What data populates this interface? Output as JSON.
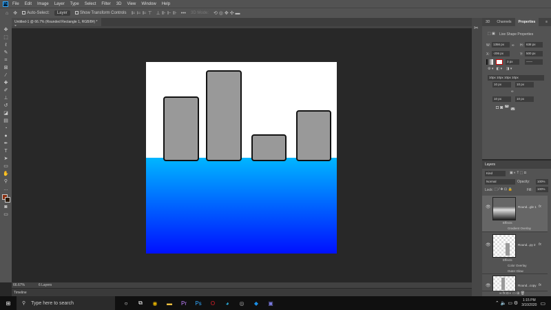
{
  "app": {
    "logo": "Ps",
    "menu": [
      "File",
      "Edit",
      "Image",
      "Layer",
      "Type",
      "Select",
      "Filter",
      "3D",
      "View",
      "Window",
      "Help"
    ]
  },
  "options": {
    "auto_select": "Auto-Select:",
    "auto_select_value": "Layer",
    "show_transform": "Show Transform Controls",
    "mode_3d": "3D Mode:"
  },
  "document": {
    "tab_title": "Untitled-1 @ 66.7% (Rounded Rectangle 1, RGB/8#) *",
    "close": "×",
    "zoom": "66.67%",
    "layers_count": "6 Layers",
    "colors": {
      "gradient_top": "#00b6ff",
      "gradient_bottom": "#0010ff",
      "bar_fill": "#999999"
    }
  },
  "properties": {
    "tabs": [
      "3D",
      "Channels",
      "Properties"
    ],
    "header": "Live Shape Properties",
    "w_label": "W:",
    "w": "1356 px",
    "h_label": "H:",
    "h": "638 px",
    "x_label": "X:",
    "x": "-206 px",
    "y_label": "Y:",
    "y": "500 px",
    "stroke": "3 px",
    "radii": "10px 10px 10px 10px",
    "r1": "10 px",
    "r2": "10 px",
    "r3": "10 px",
    "r4": "10 px"
  },
  "layers": {
    "title": "Layers",
    "kind": "Kind",
    "blend": "Normal",
    "opacity_label": "Opacity:",
    "opacity": "100%",
    "lock_label": "Lock:",
    "fill_label": "Fill:",
    "fill": "100%",
    "items": [
      {
        "name": "Round...gle 1",
        "effects": [
          "Effects",
          "Gradient Overlay"
        ]
      },
      {
        "name": "Round...py 2",
        "effects": [
          "Effects",
          "Color Overlay",
          "Outer Glow"
        ]
      },
      {
        "name": "Round...copy",
        "effects": []
      }
    ]
  },
  "timeline": {
    "label": "Timeline"
  },
  "taskbar": {
    "search_placeholder": "Type here to search",
    "time": "1:15 PM",
    "date": "3/10/2020"
  }
}
